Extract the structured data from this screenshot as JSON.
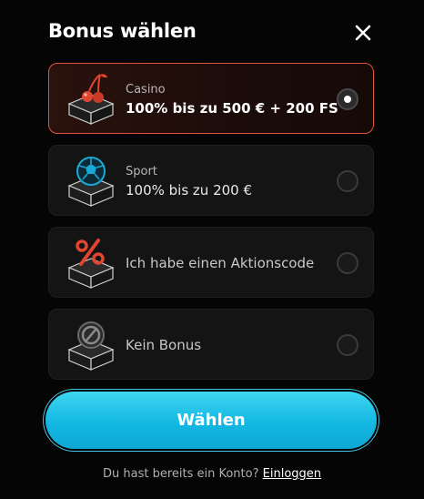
{
  "modal": {
    "title": "Bonus wählen",
    "close_icon": "close-icon"
  },
  "options": [
    {
      "id": "casino",
      "icon": "casino-joystick-icon",
      "sublabel": "Casino",
      "label": "100% bis zu 500 € + 200 FS",
      "selected": true
    },
    {
      "id": "sport",
      "icon": "soccer-ball-icon",
      "sublabel": "Sport",
      "label": "100% bis zu 200 €",
      "selected": false
    },
    {
      "id": "promo",
      "icon": "percent-icon",
      "sublabel": "",
      "label": "Ich habe einen Aktionscode",
      "selected": false
    },
    {
      "id": "none",
      "icon": "no-bonus-icon",
      "sublabel": "",
      "label": "Kein Bonus",
      "selected": false
    }
  ],
  "cta": {
    "label": "Wählen"
  },
  "footer": {
    "text": "Du hast bereits ein Konto?",
    "link": "Einloggen"
  },
  "colors": {
    "accent_cyan": "#13b8e3",
    "selected_border": "#e0533a",
    "icon_red": "#e0452f",
    "icon_blue": "#1aa9d6"
  }
}
